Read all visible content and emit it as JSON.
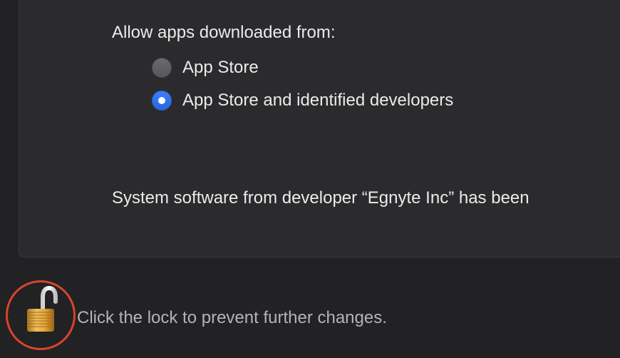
{
  "security": {
    "allow_label": "Allow apps downloaded from:",
    "options": [
      {
        "label": "App Store",
        "selected": false
      },
      {
        "label": "App Store and identified developers",
        "selected": true
      }
    ],
    "system_message": "System software from developer “Egnyte Inc” has been"
  },
  "footer": {
    "lock_text": "Click the lock to prevent further changes.",
    "lock_icon": "unlocked-padlock-icon",
    "highlight_color": "#d9442c"
  },
  "colors": {
    "accent": "#2f6fe8",
    "background": "#222124",
    "panel": "#2b2a2d"
  }
}
